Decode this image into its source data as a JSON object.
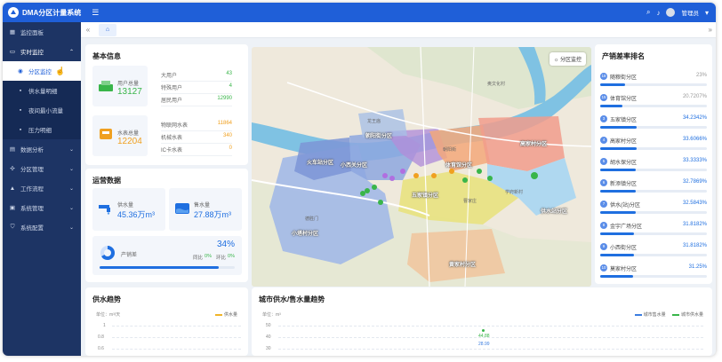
{
  "app": {
    "title": "DMA分区计量系统",
    "user": "管理员"
  },
  "sidebar": {
    "items": [
      {
        "label": "监控面板",
        "icon": "grid-icon"
      },
      {
        "label": "实时监控",
        "icon": "monitor-icon",
        "expanded": true
      },
      {
        "label": "数据分析",
        "icon": "chart-icon"
      },
      {
        "label": "分区管理",
        "icon": "partition-icon"
      },
      {
        "label": "工作流程",
        "icon": "workflow-icon"
      },
      {
        "label": "系统管理",
        "icon": "system-icon"
      },
      {
        "label": "系统配置",
        "icon": "shield-icon"
      }
    ],
    "sub_items": [
      {
        "label": "分区监控",
        "active": true
      },
      {
        "label": "供水量明细"
      },
      {
        "label": "夜间最小流量"
      },
      {
        "label": "压力明细"
      }
    ]
  },
  "basic_info": {
    "title": "基本信息",
    "users": {
      "label": "用户总量",
      "value": "13127"
    },
    "user_types": [
      {
        "label": "大用户",
        "value": "43"
      },
      {
        "label": "特殊用户",
        "value": "4"
      },
      {
        "label": "居民用户",
        "value": "12990"
      }
    ],
    "meters": {
      "label": "水表总量",
      "value": "12204"
    },
    "meter_types": [
      {
        "label": "物联网水表",
        "value": "11864"
      },
      {
        "label": "机械水表",
        "value": "340"
      },
      {
        "label": "IC卡水表",
        "value": "0"
      }
    ]
  },
  "operations": {
    "title": "运营数据",
    "supply": {
      "label": "供水量",
      "value": "45.36万m³"
    },
    "sales": {
      "label": "售水量",
      "value": "27.88万m³"
    },
    "loss": {
      "label": "产销差",
      "value": "34%",
      "fraction": 0.34,
      "yoy_label": "同比",
      "yoy_value": "0%",
      "mom_label": "环比",
      "mom_value": "0%"
    }
  },
  "map": {
    "button_label": "分区监控",
    "regions": [
      "朝阳街分区",
      "火车站分区",
      "小西关分区",
      "体育馆分区",
      "五家镇分区",
      "高家村分区",
      "供水站分区",
      "小塔村分区",
      "黄家村分区"
    ],
    "place_labels": [
      "奥文化村",
      "朝阳街",
      "龙王庙",
      "曹家庄",
      "学府新村",
      "德胜门"
    ]
  },
  "ranking": {
    "title": "产销差率排名",
    "items": [
      {
        "rank": "18",
        "name": "随粮街分区",
        "value": "23%",
        "fraction": 0.23
      },
      {
        "rank": "15",
        "name": "体育馆分区",
        "value": "20.7207%",
        "fraction": 0.21
      },
      {
        "rank": "3",
        "name": "五家镇分区",
        "value": "34.2342%",
        "fraction": 0.34
      },
      {
        "rank": "4",
        "name": "高家村分区",
        "value": "33.6066%",
        "fraction": 0.34
      },
      {
        "rank": "5",
        "name": "胡水保分区",
        "value": "33.3333%",
        "fraction": 0.33
      },
      {
        "rank": "6",
        "name": "新添镇分区",
        "value": "32.7869%",
        "fraction": 0.33
      },
      {
        "rank": "7",
        "name": "供水(站)分区",
        "value": "32.5843%",
        "fraction": 0.33
      },
      {
        "rank": "8",
        "name": "金宇广场分区",
        "value": "31.8182%",
        "fraction": 0.32
      },
      {
        "rank": "9",
        "name": "小西街分区",
        "value": "31.8182%",
        "fraction": 0.32
      },
      {
        "rank": "10",
        "name": "莫家村分区",
        "value": "31.25%",
        "fraction": 0.31
      }
    ]
  },
  "supply_trend": {
    "title": "供水趋势",
    "unit": "单位：m³/天",
    "legend": "供水量",
    "y_ticks": [
      "1",
      "0.8",
      "0.6"
    ],
    "colors": {
      "supply": "#f0b429"
    }
  },
  "city_trend": {
    "title": "城市供水/售水量趋势",
    "unit": "单位：m³",
    "legend": [
      "城市售水量",
      "城市供水量"
    ],
    "y_ticks": [
      "50",
      "40",
      "30"
    ],
    "data_labels": [
      "44.88",
      "28.99"
    ],
    "colors": {
      "sales": "#3b7de0",
      "supply": "#39b54a"
    }
  }
}
